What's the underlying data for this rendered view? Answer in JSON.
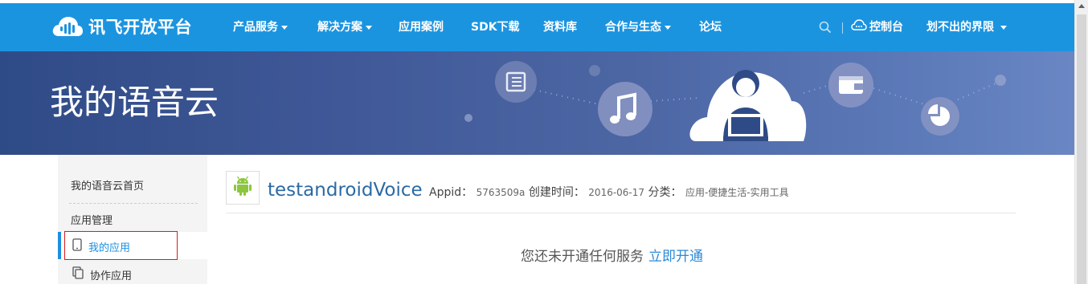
{
  "brand": {
    "logo_text": "讯飞开放平台"
  },
  "nav": {
    "items": [
      {
        "label": "产品服务",
        "has_caret": true
      },
      {
        "label": "解决方案",
        "has_caret": true
      },
      {
        "label": "应用案例",
        "has_caret": false
      },
      {
        "label": "SDK下载",
        "has_caret": false
      },
      {
        "label": "资料库",
        "has_caret": false
      },
      {
        "label": "合作与生态",
        "has_caret": true
      },
      {
        "label": "论坛",
        "has_caret": false
      }
    ],
    "console_label": "控制台",
    "username": "划不出的界限"
  },
  "banner": {
    "title": "我的语音云",
    "icons": [
      "document-icon",
      "music-icon",
      "user-laptop-cloud-icon",
      "wallet-icon",
      "pie-chart-icon"
    ]
  },
  "sidebar": {
    "home": "我的语音云首页",
    "group_title": "应用管理",
    "items": [
      {
        "label": "我的应用",
        "active": true
      },
      {
        "label": "协作应用",
        "active": false
      }
    ]
  },
  "app": {
    "name": "testandroidVoice",
    "appid_label": "Appid：",
    "appid_value": "5763509a",
    "created_label": "创建时间：",
    "created_value": "2016-06-17",
    "category_label": "分类：",
    "category_value": "应用-便捷生活-实用工具"
  },
  "empty_state": {
    "message": "您还未开通任何服务",
    "action": "立即开通"
  },
  "colors": {
    "nav_bg": "#1b94e0",
    "link": "#2a8ad8",
    "app_name": "#2b6aa5",
    "highlight_border": "#d21f1f",
    "android_green": "#8cc63f"
  }
}
